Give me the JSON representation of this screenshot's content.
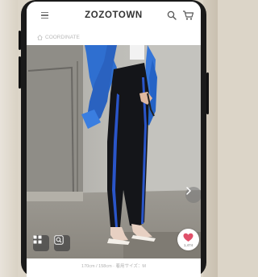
{
  "header": {
    "logo_text": "ZOZOTOWN",
    "menu_icon": "hamburger-menu-icon",
    "search_icon": "search-icon",
    "cart_icon": "cart-icon"
  },
  "breadcrumb": {
    "home_icon": "home-icon",
    "label": "COORDINATE"
  },
  "photo": {
    "next_icon": "chevron-right-icon",
    "grid_icon": "grid-icon",
    "zoom_icon": "zoom-search-icon",
    "like_icon": "heart-icon",
    "like_count": "1,474"
  },
  "caption": "170cm / 158cm · 着用サイズ：M",
  "colors": {
    "accent_heart": "#e0506a",
    "jacket_blue": "#2f6fd0",
    "stripe_blue": "#2a55c9"
  }
}
